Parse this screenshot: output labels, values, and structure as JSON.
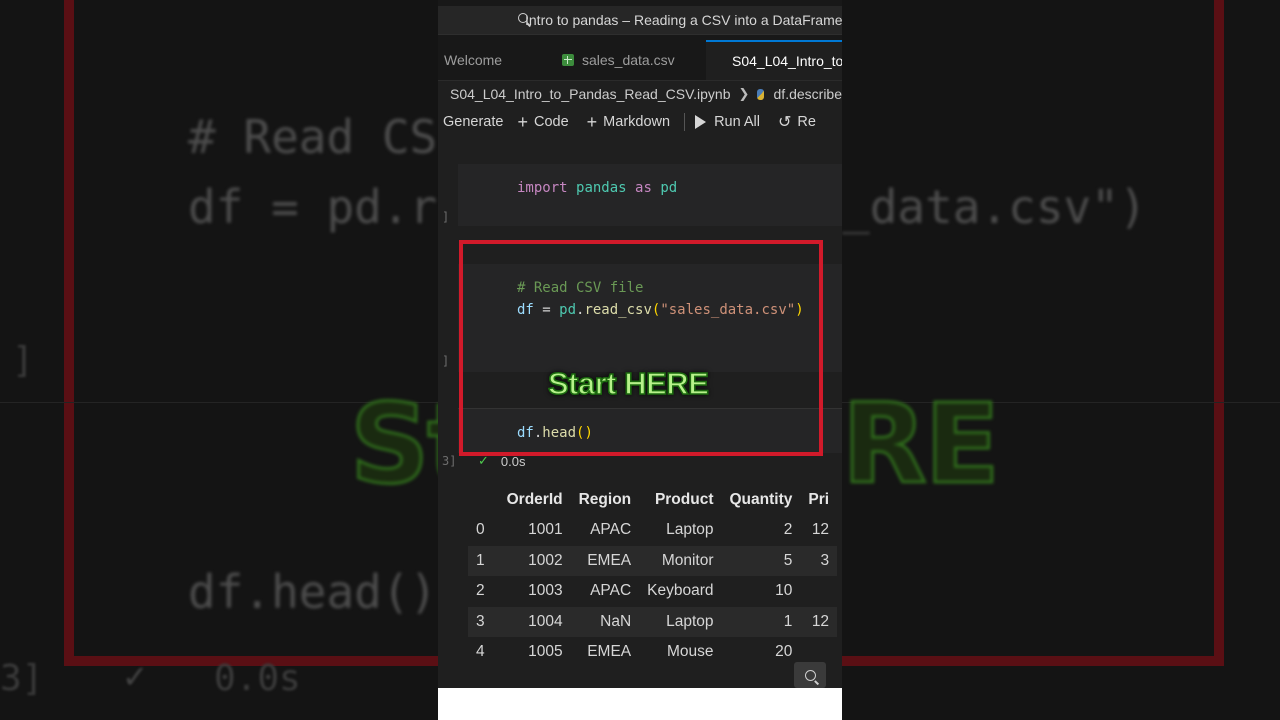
{
  "window": {
    "search_title": "Intro to pandas – Reading a CSV into a DataFrame"
  },
  "tabs": [
    {
      "label": "Welcome",
      "icon": "none"
    },
    {
      "label": "sales_data.csv",
      "icon": "csv-file-icon"
    },
    {
      "label": "S04_L04_Intro_to",
      "icon": "notebook-file-icon",
      "active": true
    }
  ],
  "breadcrumb": {
    "file": "S04_L04_Intro_to_Pandas_Read_CSV.ipynb",
    "symbol": "df.describe"
  },
  "toolbar": {
    "generate": "Generate",
    "code": "Code",
    "markdown": "Markdown",
    "run_all": "Run All",
    "restart": "Re"
  },
  "cells": {
    "c1": {
      "kw1": "import",
      "mod": "pandas",
      "kw2": "as",
      "alias": "pd"
    },
    "c2": {
      "comment": "# Read CSV file",
      "var": "df",
      "eq": " = ",
      "obj": "pd",
      "dot": ".",
      "fn": "read_csv",
      "open": "(",
      "arg": "\"sales_data.csv\"",
      "close": ")"
    },
    "c3": {
      "var": "df",
      "dot": ".",
      "fn": "head",
      "parens": "()"
    }
  },
  "overlay": {
    "label": "Start HERE"
  },
  "execution": {
    "time": "0.0s"
  },
  "table": {
    "columns": [
      "",
      "OrderId",
      "Region",
      "Product",
      "Quantity",
      "Pri"
    ],
    "rows": [
      [
        "0",
        "1001",
        "APAC",
        "Laptop",
        "2",
        "12"
      ],
      [
        "1",
        "1002",
        "EMEA",
        "Monitor",
        "5",
        "3"
      ],
      [
        "2",
        "1003",
        "APAC",
        "Keyboard",
        "10",
        ""
      ],
      [
        "3",
        "1004",
        "NaN",
        "Laptop",
        "1",
        "12"
      ],
      [
        "4",
        "1005",
        "EMEA",
        "Mouse",
        "20",
        ""
      ]
    ]
  },
  "backdrop": {
    "comment": "# Read CS",
    "line1": "df = pd.r",
    "line1_tail": "_data.csv\")",
    "green": "St",
    "green_tail": "RE",
    "head": "df.head()",
    "exec": "0.0s",
    "bracket": "]",
    "bracket2": "3]"
  },
  "colors": {
    "accent": "#0078d4",
    "highlight_border": "#d11a2a",
    "overlay_text": "#b6f28a",
    "check": "#4ec94e"
  }
}
